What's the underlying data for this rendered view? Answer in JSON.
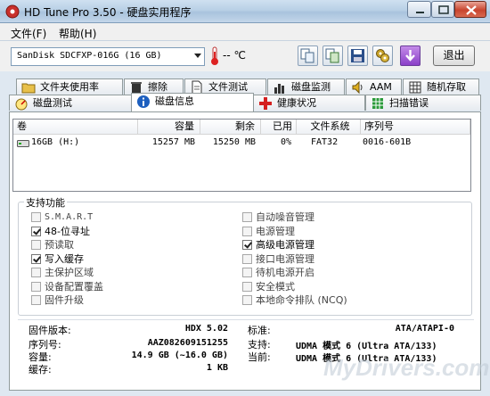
{
  "window": {
    "title": "HD Tune Pro 3.50 - 硬盘实用程序"
  },
  "menu": {
    "file": "文件(F)",
    "help": "帮助(H)"
  },
  "toolbar": {
    "drive": "SanDisk SDCFXP-016G (16 GB)",
    "temperature": "-- ℃",
    "exit_label": "退出"
  },
  "tabs": {
    "row1": [
      "文件夹使用率",
      "擦除",
      "文件测试",
      "磁盘监测",
      "AAM",
      "随机存取"
    ],
    "row2": [
      "磁盘测试",
      "磁盘信息",
      "健康状况",
      "扫描错误"
    ],
    "active": "磁盘信息"
  },
  "volumes": {
    "headers": [
      "卷",
      "容量",
      "剩余",
      "已用",
      "文件系统",
      "序列号"
    ],
    "rows": [
      {
        "volume": "16GB (H:)",
        "capacity": "15257 MB",
        "free": "15250 MB",
        "used": "0%",
        "fs": "FAT32",
        "serial": "0016-601B"
      }
    ]
  },
  "features": {
    "title": "支持功能",
    "left": [
      {
        "label": "S.M.A.R.T",
        "checked": false
      },
      {
        "label": "48-位寻址",
        "checked": true
      },
      {
        "label": "预读取",
        "checked": false
      },
      {
        "label": "写入缓存",
        "checked": true
      },
      {
        "label": "主保护区域",
        "checked": false
      },
      {
        "label": "设备配置覆盖",
        "checked": false
      },
      {
        "label": "固件升级",
        "checked": false
      }
    ],
    "right": [
      {
        "label": "自动噪音管理",
        "checked": false
      },
      {
        "label": "电源管理",
        "checked": false
      },
      {
        "label": "高级电源管理",
        "checked": true
      },
      {
        "label": "接口电源管理",
        "checked": false
      },
      {
        "label": "待机电源开启",
        "checked": false
      },
      {
        "label": "安全模式",
        "checked": false
      },
      {
        "label": "本地命令排队 (NCQ)",
        "checked": false
      }
    ]
  },
  "info": {
    "firmware_label": "固件版本:",
    "firmware": "HDX 5.02",
    "serial_label": "序列号:",
    "serial": "AAZ082609151255",
    "capacity_label": "容量:",
    "capacity": "14.9 GB (~16.0 GB)",
    "cache_label": "缓存:",
    "cache": "1 KB",
    "standard_label": "标准:",
    "standard": "ATA/ATAPI-0",
    "supported_label": "支持:",
    "supported": "UDMA 模式 6 (Ultra ATA/133)",
    "current_label": "当前:",
    "current": "UDMA 模式 6 (Ultra ATA/133)"
  },
  "watermark": "MyDrivers.com"
}
